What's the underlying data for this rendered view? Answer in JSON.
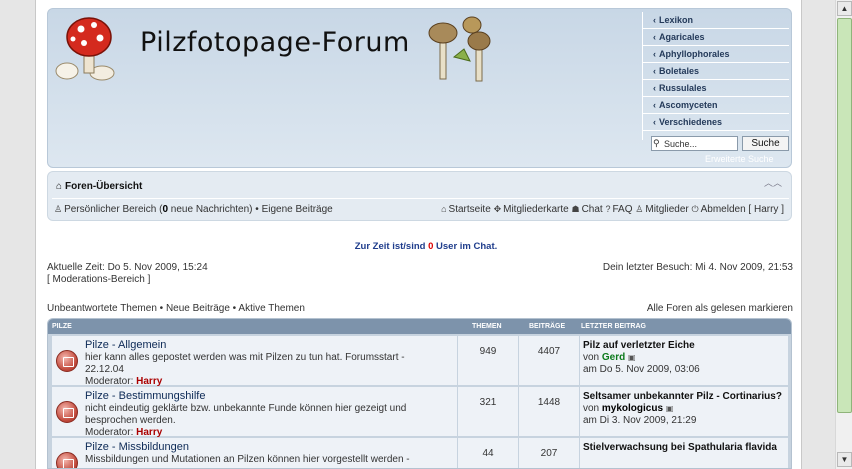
{
  "site": {
    "title": "Pilzfotopage-Forum"
  },
  "sidemenu": [
    {
      "label": "Lexikon"
    },
    {
      "label": "Agaricales"
    },
    {
      "label": "Aphyllophorales"
    },
    {
      "label": "Boletales"
    },
    {
      "label": "Russulales"
    },
    {
      "label": "Ascomyceten"
    },
    {
      "label": "Verschiedenes"
    }
  ],
  "search": {
    "placeholder": "Suche...",
    "button": "Suche",
    "advanced": "Erweiterte Suche"
  },
  "navbar": {
    "breadcrumb": "Foren-Übersicht",
    "personal_prefix": "Persönlicher Bereich (",
    "new_messages": "0",
    "personal_suffix": " neue Nachrichten)",
    "separator": " • ",
    "own_posts": "Eigene Beiträge",
    "links": [
      {
        "icon": "home-icon",
        "label": "Startseite"
      },
      {
        "icon": "map-icon",
        "label": "Mitgliederkarte"
      },
      {
        "icon": "chat-icon",
        "label": "Chat"
      },
      {
        "icon": "faq-icon",
        "label": "FAQ"
      },
      {
        "icon": "members-icon",
        "label": "Mitglieder"
      },
      {
        "icon": "power-icon",
        "label": "Abmelden [ Harry ]"
      }
    ]
  },
  "chat": {
    "prefix": "Zur Zeit ist/sind ",
    "count": "0",
    "suffix": " User im Chat."
  },
  "info": {
    "current_time": "Aktuelle Zeit: Do 5. Nov 2009, 15:24",
    "moderation": "[ Moderations-Bereich ]",
    "last_visit": "Dein letzter Besuch: Mi 4. Nov 2009, 21:53"
  },
  "quicklinks": {
    "unanswered": "Unbeantwortete Themen",
    "new_posts": "Neue Beiträge",
    "active": "Aktive Themen",
    "mark_read": "Alle Foren als gelesen markieren"
  },
  "forum_table": {
    "headers": {
      "category": "PILZE",
      "topics": "THEMEN",
      "posts": "BEITRÄGE",
      "last_post": "LETZTER BEITRAG"
    },
    "rows": [
      {
        "title": "Pilze - Allgemein",
        "description": "hier kann alles gepostet werden was mit Pilzen zu tun hat. Forumsstart - 22.12.04",
        "moderator_label": "Moderator: ",
        "moderator": "Harry",
        "topics": "949",
        "posts": "4407",
        "last_title": "Pilz auf verletzter Eiche",
        "last_by": "von ",
        "last_author": "Gerd",
        "last_date": "am Do 5. Nov 2009, 03:06"
      },
      {
        "title": "Pilze - Bestimmungshilfe",
        "description": "nicht eindeutig geklärte bzw. unbekannte Funde können hier gezeigt und besprochen werden.",
        "moderator_label": "Moderator: ",
        "moderator": "Harry",
        "topics": "321",
        "posts": "1448",
        "last_title": "Seltsamer unbekannter Pilz - Cortinarius?",
        "last_by": "von ",
        "last_author": "mykologicus",
        "last_date": "am Di 3. Nov 2009, 21:29"
      },
      {
        "title": "Pilze - Missbildungen",
        "description": "Missbildungen und Mutationen an Pilzen können hier vorgestellt werden -",
        "moderator_label": "",
        "moderator": "",
        "topics": "44",
        "posts": "207",
        "last_title": "Stielverwachsung bei Spathularia flavida",
        "last_by": "",
        "last_author": "",
        "last_date": ""
      }
    ]
  }
}
